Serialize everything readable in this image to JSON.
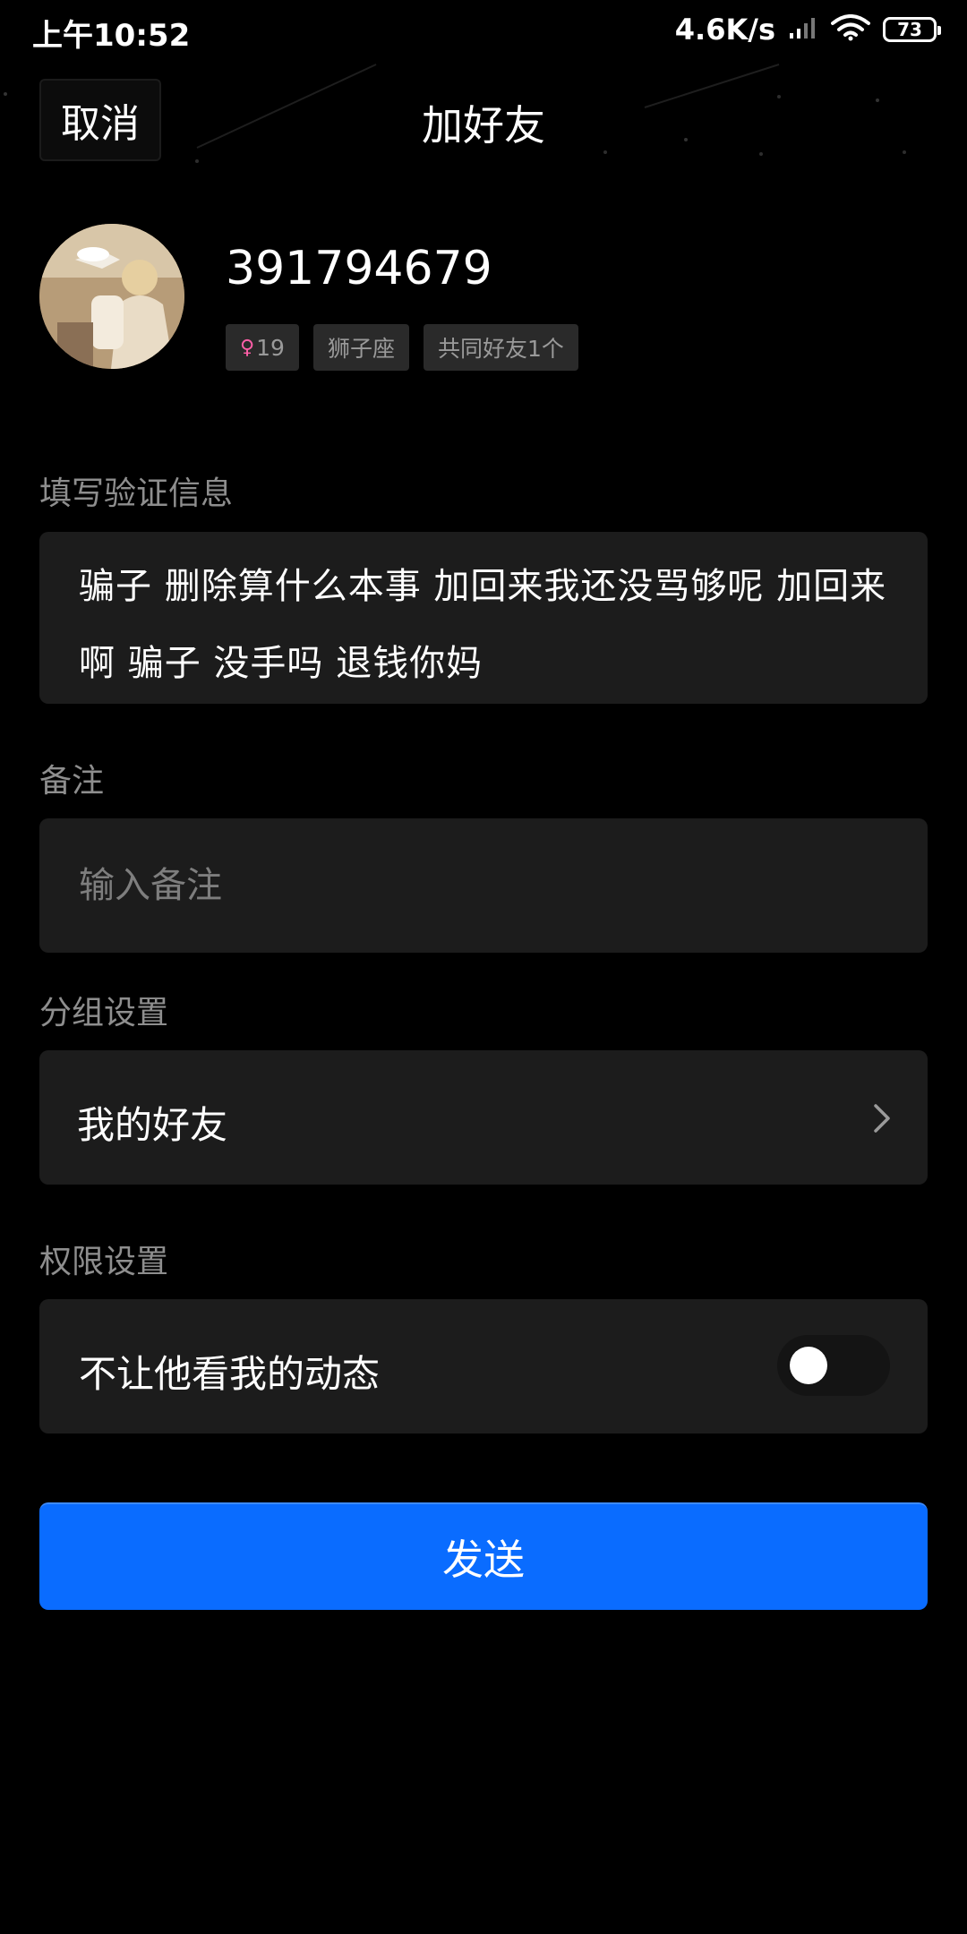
{
  "status_bar": {
    "time": "上午10:52",
    "net_speed": "4.6K/s",
    "battery_level": "73",
    "icons": [
      "signal-icon",
      "wifi-icon",
      "battery-icon"
    ]
  },
  "nav": {
    "cancel_label": "取消",
    "title": "加好友"
  },
  "profile": {
    "user_id": "391794679",
    "gender_icon": "female-icon",
    "age": "19",
    "zodiac": "狮子座",
    "mutual_friends": "共同好友1个"
  },
  "verify": {
    "label": "填写验证信息",
    "message": "骗子 删除算什么本事 加回来我还没骂够呢 加回来啊 骗子 没手吗 退钱你妈"
  },
  "remark": {
    "label": "备注",
    "placeholder": "输入备注",
    "value": ""
  },
  "group": {
    "label": "分组设置",
    "value": "我的好友"
  },
  "permission": {
    "label": "权限设置",
    "item_label": "不让他看我的动态",
    "enabled": false
  },
  "actions": {
    "send_label": "发送"
  },
  "colors": {
    "background": "#000000",
    "card": "#1c1c1c",
    "accent": "#0a6cff",
    "female": "#ff5fa8"
  }
}
